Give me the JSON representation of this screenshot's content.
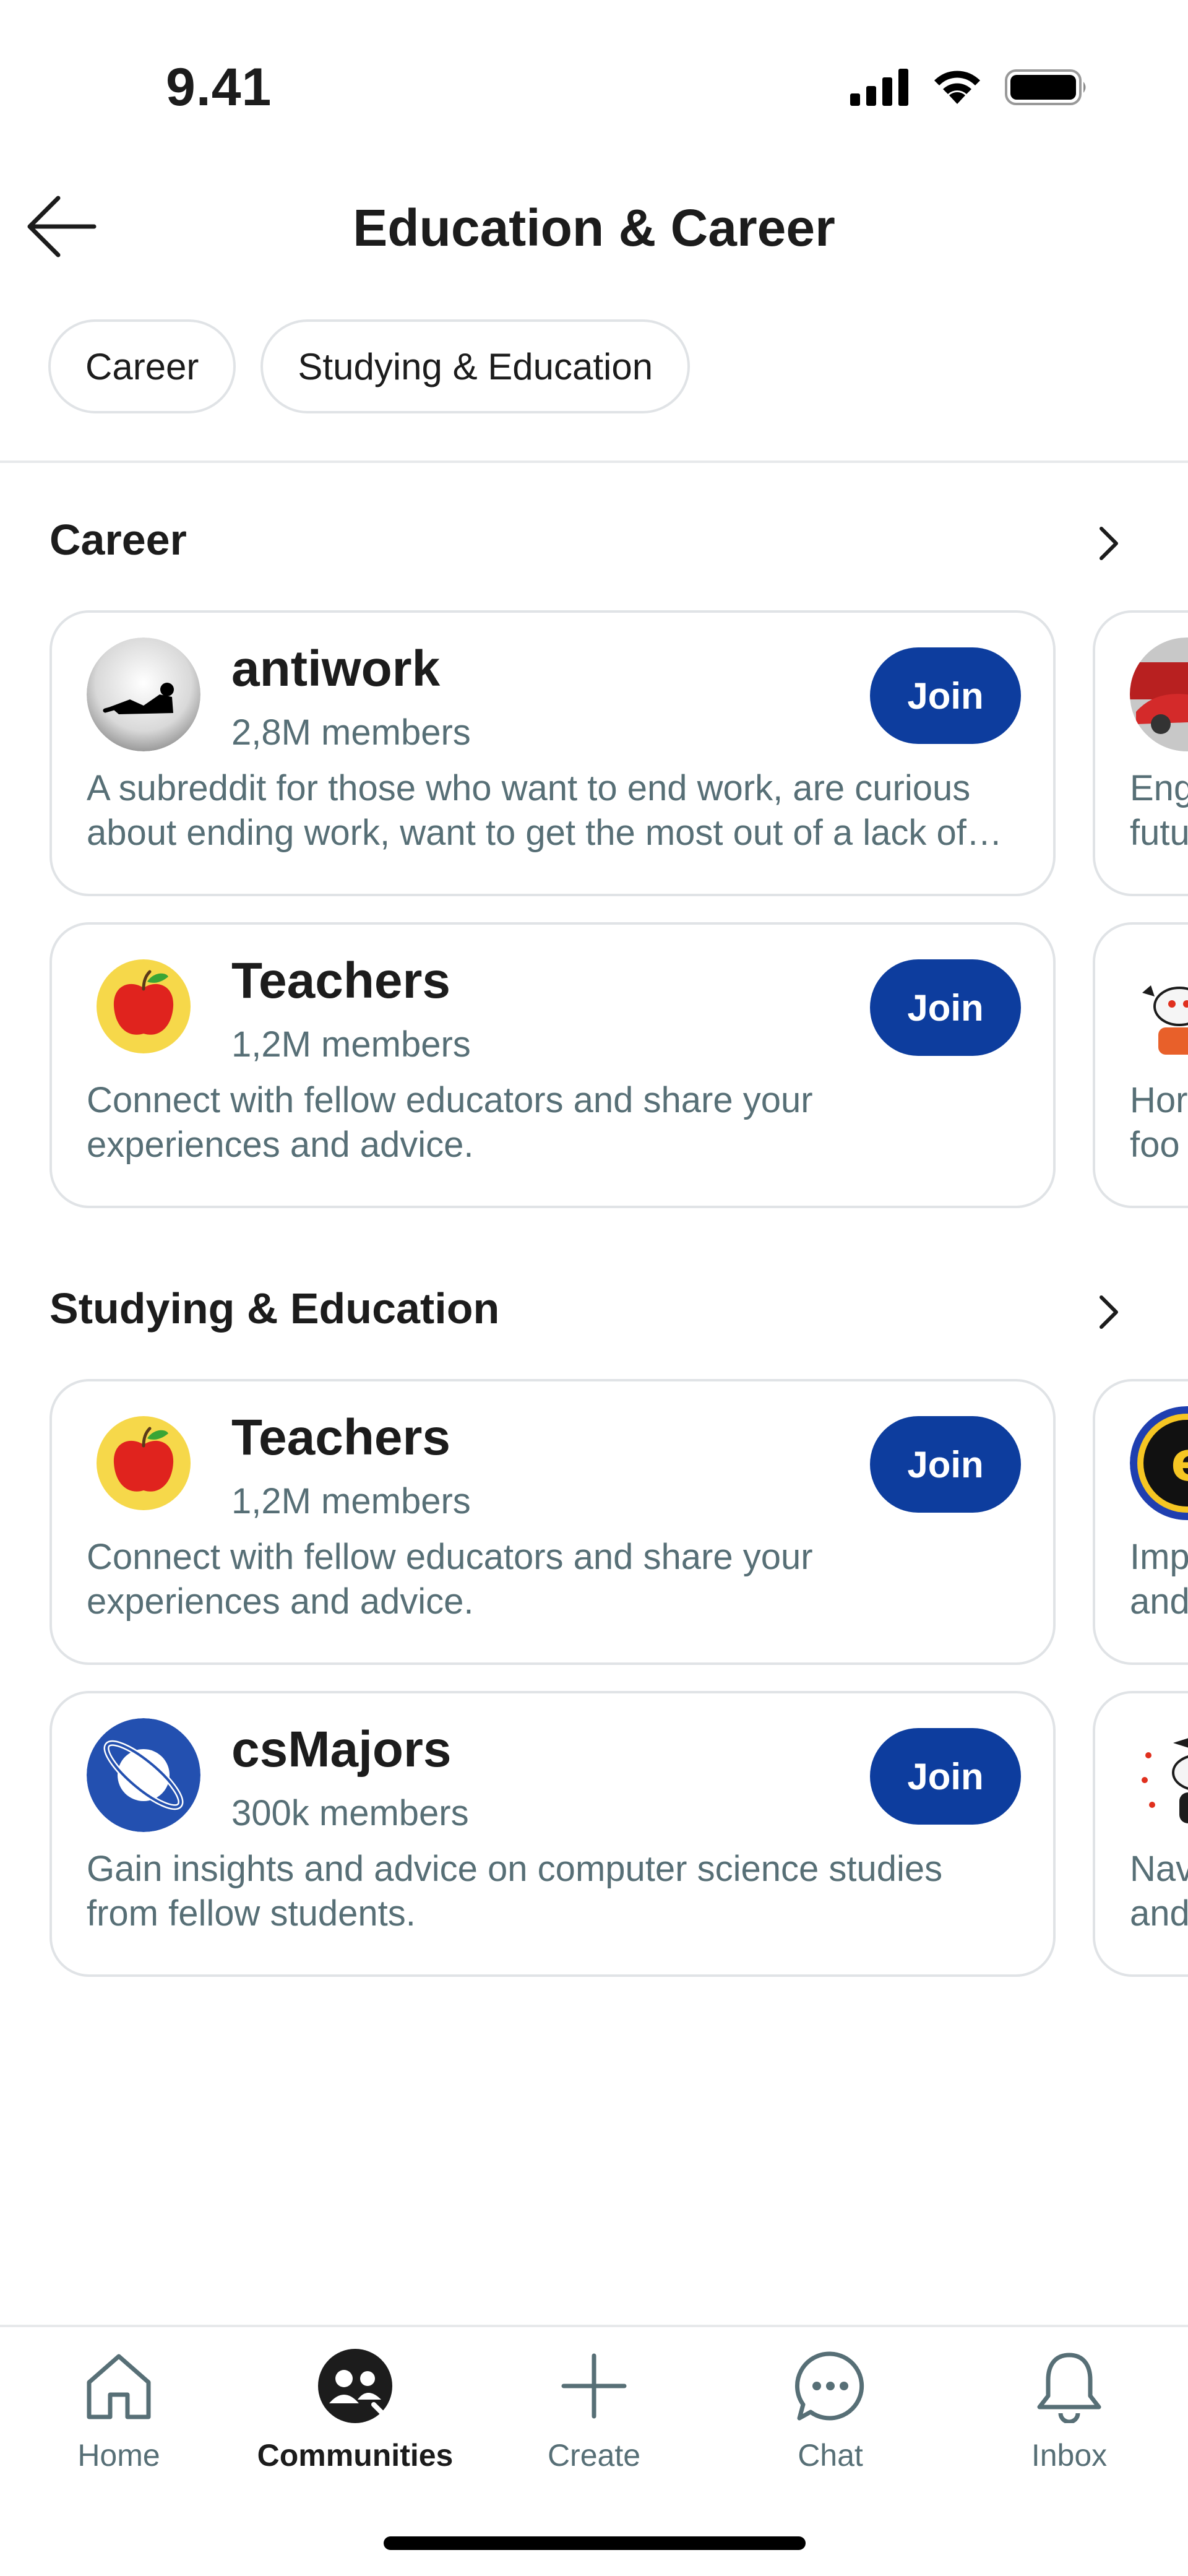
{
  "status_bar": {
    "time": "9.41"
  },
  "header": {
    "title": "Education & Career"
  },
  "chips": [
    "Career",
    "Studying & Education"
  ],
  "sections": [
    {
      "title": "Career",
      "cards": [
        {
          "name": "antiwork",
          "members": "2,8M members",
          "description": "A subreddit for those who want to end work, are curious about ending work, want to get the most out of a lack of work, want to relate to others who feel the same way",
          "join_label": "Join"
        },
        {
          "name": "Teachers",
          "members": "1,2M members",
          "description": "Connect with fellow educators and share your experiences and advice.",
          "join_label": "Join"
        }
      ],
      "peek_cards": [
        {
          "text_lines": [
            "Eng",
            "futu"
          ]
        },
        {
          "text_lines": [
            "Hor",
            "foo"
          ]
        }
      ]
    },
    {
      "title": "Studying & Education",
      "cards": [
        {
          "name": "Teachers",
          "members": "1,2M members",
          "description": "Connect with fellow educators and share your experiences and advice.",
          "join_label": "Join"
        },
        {
          "name": "csMajors",
          "members": "300k members",
          "description": "Gain insights and advice on computer science studies from fellow students.",
          "join_label": "Join"
        }
      ],
      "peek_cards": [
        {
          "text_lines": [
            "Imp",
            "and"
          ]
        },
        {
          "text_lines": [
            "Nav",
            "and"
          ]
        }
      ]
    }
  ],
  "bottom_nav": [
    {
      "label": "Home",
      "icon": "home-icon",
      "active": false
    },
    {
      "label": "Communities",
      "icon": "communities-icon",
      "active": true
    },
    {
      "label": "Create",
      "icon": "plus-icon",
      "active": false
    },
    {
      "label": "Chat",
      "icon": "chat-icon",
      "active": false
    },
    {
      "label": "Inbox",
      "icon": "bell-icon",
      "active": false
    }
  ],
  "colors": {
    "join_button": "#0d3d9e",
    "secondary_text": "#576f76",
    "border": "#e0e3e6"
  }
}
